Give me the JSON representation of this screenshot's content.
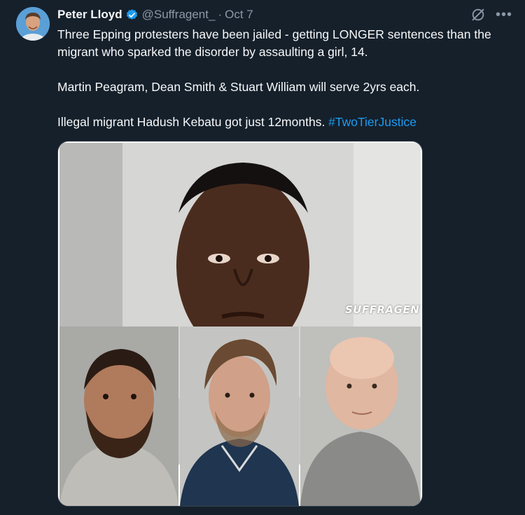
{
  "post": {
    "author_name": "Peter Lloyd",
    "handle": "@Suffragent_",
    "separator": "·",
    "date": "Oct 7",
    "more_label": "•••",
    "icons": [
      "avatar",
      "verified-badge-icon",
      "grok-icon",
      "more-icon"
    ],
    "text_line1": "Three Epping protesters have been jailed - getting LONGER sentences than the migrant who sparked the disorder by assaulting a girl, 14.",
    "text_line2": "Martin Peagram, Dean Smith & Stuart William will serve 2yrs each.",
    "text_line3_prefix": "Illegal migrant Hadush Kebatu got just 12months. ",
    "hashtag": "#TwoTierJustice",
    "media_watermark": "SUFFRAGENT"
  },
  "colors": {
    "background": "#15202b",
    "text": "#f7f9f9",
    "muted": "#8b98a5",
    "accent": "#1d9bf0"
  }
}
